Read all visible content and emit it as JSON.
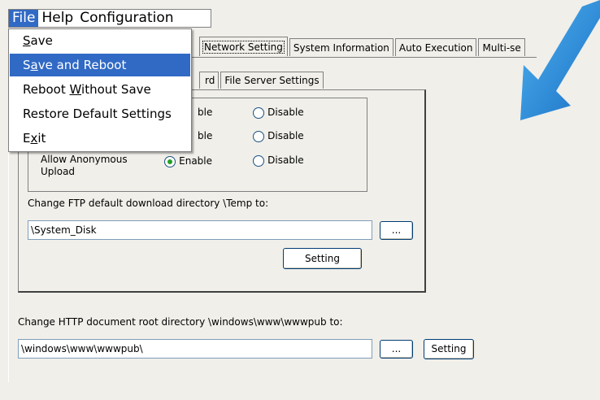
{
  "menubar": {
    "file": "File",
    "help": "Help",
    "configuration": "Configuration"
  },
  "file_menu": {
    "items": [
      {
        "label": "Save",
        "underline": "S",
        "rest": "ave"
      },
      {
        "label": "Save and Reboot",
        "pre": "S",
        "underline": "a",
        "rest": "ve and Reboot"
      },
      {
        "label": "Reboot Without Save",
        "pre": "Reboot ",
        "underline": "W",
        "rest": "ithout Save"
      },
      {
        "label": "Restore Default Settings"
      },
      {
        "label": "Exit",
        "pre": "E",
        "underline": "x",
        "rest": "it"
      }
    ],
    "highlighted_index": 1
  },
  "tabs": [
    "Network Setting",
    "System Information",
    "Auto Execution",
    "Multi-se"
  ],
  "selected_tab": "Network Setting",
  "sub_tabs": {
    "partial_label": "rd",
    "file_server": "File Server Settings"
  },
  "ftp_group": {
    "rows": [
      {
        "label": "",
        "enable_partial": "ble",
        "disable": "Disable",
        "enabled": false
      },
      {
        "label": "",
        "enable_partial": "ble",
        "disable": "Disable",
        "enabled": false
      },
      {
        "label_line1": "Allow Anonymous",
        "label_line2": "Upload",
        "enable": "Enable",
        "disable": "Disable",
        "enabled": true
      }
    ]
  },
  "ftp_dir": {
    "label": "Change FTP default download directory \\Temp to:",
    "value": "\\System_Disk",
    "browse": "...",
    "setting": "Setting"
  },
  "http_dir": {
    "label": "Change HTTP document root directory \\windows\\www\\wwwpub to:",
    "value": "\\windows\\www\\wwwpub\\",
    "browse": "...",
    "setting": "Setting"
  },
  "colors": {
    "menu_highlight": "#316ac5",
    "arrow": "#2a8fd8",
    "window_bg": "#f0efea"
  },
  "icons": [
    "pointer-arrow-icon"
  ]
}
